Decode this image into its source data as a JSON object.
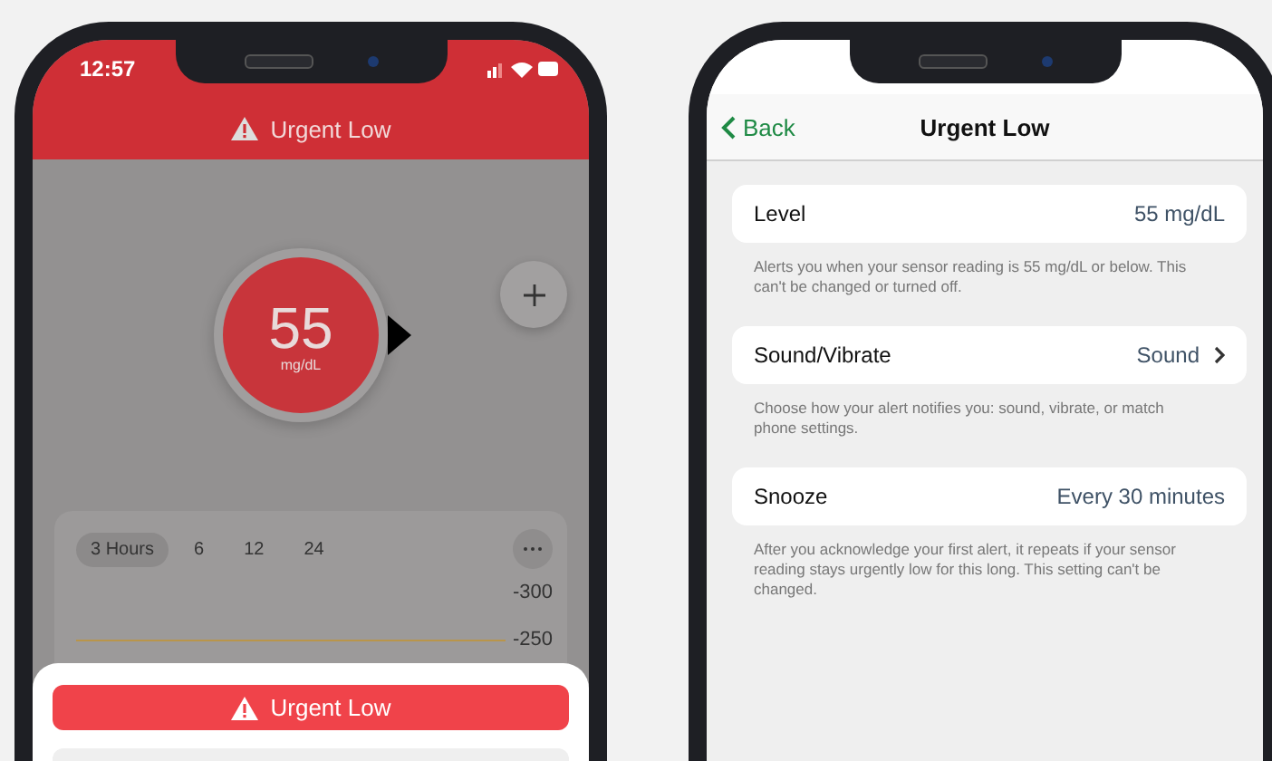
{
  "left_phone": {
    "status_bar": {
      "time": "12:57"
    },
    "header": {
      "title": "Urgent Low"
    },
    "reading": {
      "value": "55",
      "unit": "mg/dL"
    },
    "chart": {
      "ranges": [
        {
          "label": "3 Hours",
          "selected": true
        },
        {
          "label": "6",
          "selected": false
        },
        {
          "label": "12",
          "selected": false
        },
        {
          "label": "24",
          "selected": false
        }
      ],
      "y_labels": [
        "-300",
        "-250"
      ]
    },
    "alert_button": {
      "label": "Urgent Low"
    }
  },
  "right_phone": {
    "nav": {
      "back": "Back",
      "title": "Urgent Low"
    },
    "settings": [
      {
        "label": "Level",
        "value": "55 mg/dL",
        "chevron": false,
        "description": "Alerts you when your sensor reading is 55 mg/dL or below. This can't be changed or turned off."
      },
      {
        "label": "Sound/Vibrate",
        "value": "Sound",
        "chevron": true,
        "description": "Choose how your alert notifies you: sound, vibrate, or match phone settings."
      },
      {
        "label": "Snooze",
        "value": "Every 30 minutes",
        "chevron": false,
        "description": "After you acknowledge your first alert, it repeats if your sensor reading stays urgently low for this long. This setting can't be changed."
      }
    ]
  }
}
